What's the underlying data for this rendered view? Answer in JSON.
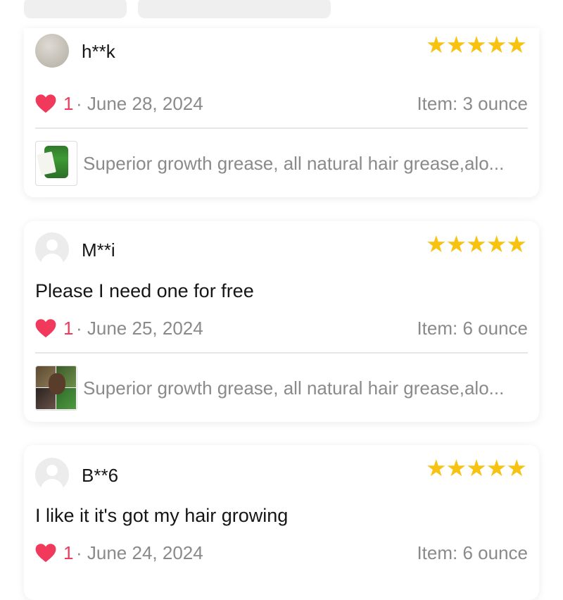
{
  "reviews": [
    {
      "username": "h**k",
      "avatar": "user-photo",
      "stars": 5,
      "text": "",
      "likes": "1",
      "date": "· June 28, 2024",
      "item": "Item: 3 ounce",
      "product": "Superior growth grease, all natural hair grease,alo..."
    },
    {
      "username": "M**i",
      "avatar": "default-avatar",
      "stars": 5,
      "text": "Please I need one for free",
      "likes": "1",
      "date": "· June 25, 2024",
      "item": "Item: 6 ounce",
      "product": "Superior growth grease, all natural hair grease,alo..."
    },
    {
      "username": "B**6",
      "avatar": "default-avatar",
      "stars": 5,
      "text": "I like it it's got my hair growing",
      "likes": "1",
      "date": "· June 24, 2024",
      "item": "Item: 6 ounce"
    }
  ],
  "colors": {
    "star": "#f8c211",
    "heart": "#f0395b",
    "meta_text": "#8a8a8a"
  }
}
